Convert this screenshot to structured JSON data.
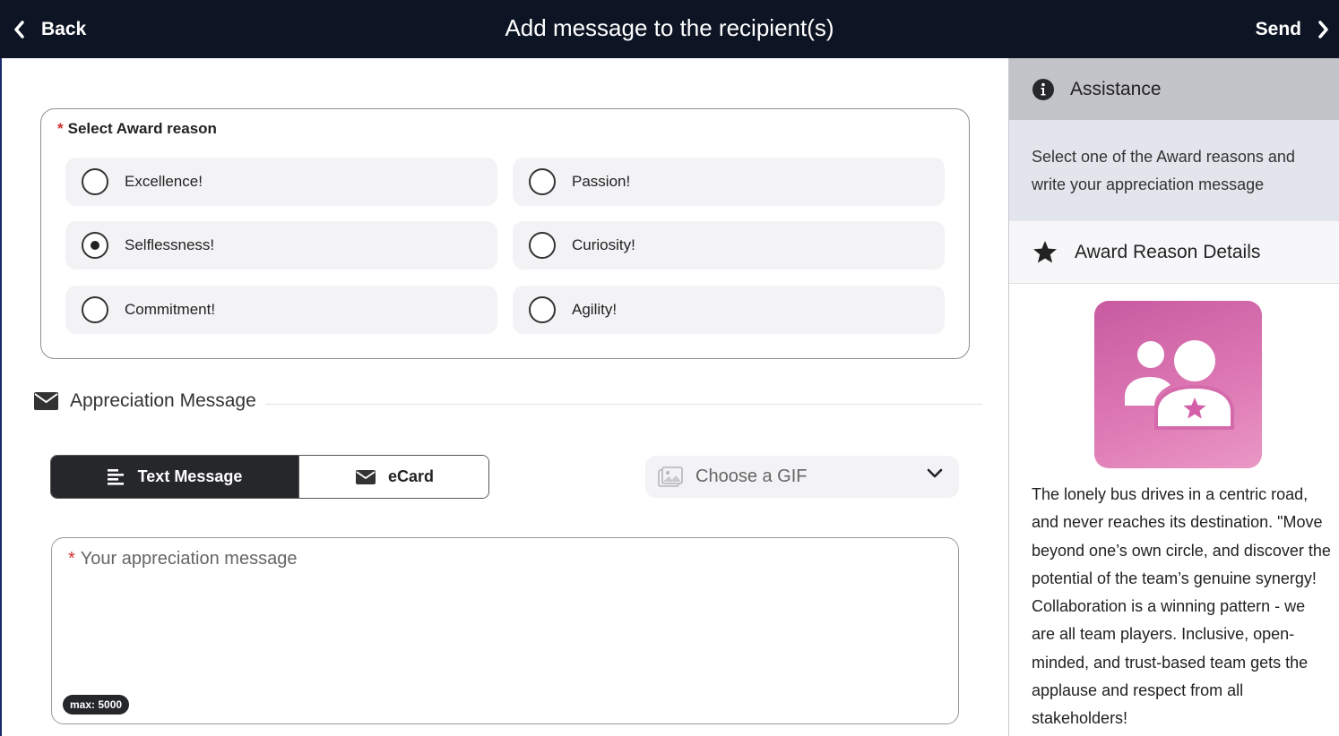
{
  "header": {
    "back_label": "Back",
    "title": "Add message to the recipient(s)",
    "send_label": "Send"
  },
  "award_reason": {
    "required_marker": "*",
    "label": "Select Award reason",
    "options": [
      {
        "label": "Excellence!",
        "selected": false
      },
      {
        "label": "Passion!",
        "selected": false
      },
      {
        "label": "Selflessness!",
        "selected": true
      },
      {
        "label": "Curiosity!",
        "selected": false
      },
      {
        "label": "Commitment!",
        "selected": false
      },
      {
        "label": "Agility!",
        "selected": false
      }
    ]
  },
  "appreciation": {
    "section_title": "Appreciation Message",
    "tabs": [
      {
        "label": "Text Message",
        "active": true,
        "icon": "align-left-icon"
      },
      {
        "label": "eCard",
        "active": false,
        "icon": "envelope-icon"
      }
    ],
    "gif_placeholder": "Choose a GIF",
    "message_required_marker": "*",
    "message_placeholder": "Your appreciation message",
    "max_badge": "max: 5000"
  },
  "sidebar": {
    "assistance_title": "Assistance",
    "assistance_text": "Select one of the Award reasons and write your appreciation message",
    "details_title": "Award Reason Details",
    "description": "The lonely bus drives in a centric road, and never reaches its destination. \"Move beyond one’s own circle, and discover the potential of the team’s genuine synergy! Collaboration is a winning pattern - we are all team players. Inclusive, open-minded, and trust-based team gets the applause and respect from all stakeholders!"
  },
  "colors": {
    "header_bg": "#0d1423",
    "active_tab_bg": "#26272b",
    "required": "#d32f2f",
    "badge_gradient_start": "#c85aa0",
    "badge_gradient_end": "#ea98c6"
  }
}
